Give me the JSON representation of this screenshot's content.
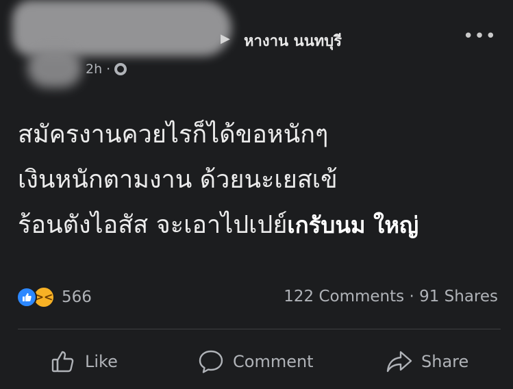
{
  "header": {
    "group_name": "หางาน นนทบุรี",
    "timestamp": "2h",
    "separator": "·",
    "arrow": "▶",
    "more": "•••"
  },
  "post": {
    "text": "สมัครงานควยไรก็ได้ขอหนักๆ\nเงินหนักตามงาน ด้วยนะเยสเข้\nร้อนตังไอสัส จะเอาไปเปย์",
    "overlay_text": "เกรับนม ใหญ่"
  },
  "reactions": {
    "count": "566",
    "types": [
      "like-icon",
      "haha-icon"
    ],
    "colors": {
      "like": "#2d88ff",
      "haha": "#f7b125"
    }
  },
  "stats": {
    "comments": "122 Comments",
    "separator": "·",
    "shares": "91 Shares"
  },
  "actions": {
    "like": "Like",
    "comment": "Comment",
    "share": "Share"
  }
}
